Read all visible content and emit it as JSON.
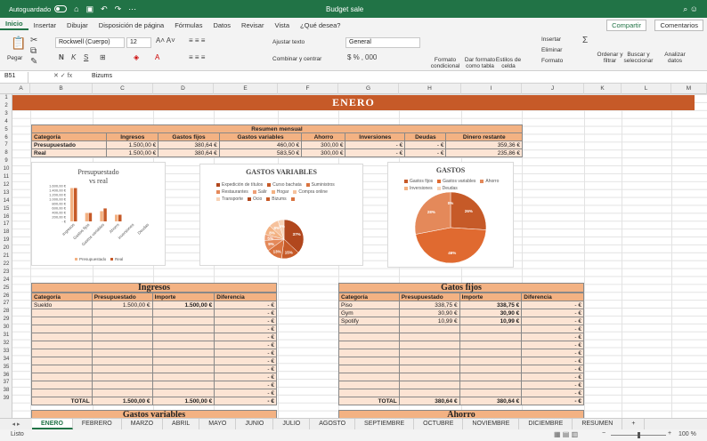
{
  "titlebar": {
    "autosave": "Autoguardado",
    "doc_title": "Budget sale"
  },
  "ribbon_tabs": [
    "Inicio",
    "Insertar",
    "Dibujar",
    "Disposición de página",
    "Fórmulas",
    "Datos",
    "Revisar",
    "Vista",
    "¿Qué desea?"
  ],
  "share": "Compartir",
  "comments": "Comentarios",
  "ribbon": {
    "paste": "Pegar",
    "font_name": "Rockwell (Cuerpo)",
    "font_size": "12",
    "wrap": "Ajustar texto",
    "merge": "Combinar y centrar",
    "number_format": "General",
    "cond_format": "Formato condicional",
    "table_format": "Dar formato como tabla",
    "cell_styles": "Estilos de celda",
    "insert": "Insertar",
    "delete": "Eliminar",
    "format": "Formato",
    "sort": "Ordenar y filtrar",
    "find": "Buscar y seleccionar",
    "analyze": "Analizar datos"
  },
  "formula_bar": {
    "cell": "B51",
    "value": "Bizums"
  },
  "columns": [
    "A",
    "B",
    "C",
    "D",
    "E",
    "F",
    "G",
    "H",
    "I",
    "J",
    "K",
    "L",
    "M"
  ],
  "rows": [
    "1",
    "2",
    "3",
    "4",
    "5",
    "6",
    "7",
    "8",
    "9",
    "10",
    "11",
    "12",
    "13",
    "14",
    "15",
    "16",
    "17",
    "18",
    "19",
    "20",
    "21",
    "22",
    "23",
    "24",
    "25",
    "26",
    "27",
    "28",
    "29",
    "30",
    "31",
    "32",
    "33",
    "34",
    "35",
    "36",
    "37",
    "38",
    "39"
  ],
  "banner": "ENERO",
  "summary": {
    "title": "Resumen mensual",
    "headers": [
      "Categoría",
      "Ingresos",
      "Gastos fijos",
      "Gastos variables",
      "Ahorro",
      "Inversiones",
      "Deudas",
      "Dinero restante"
    ],
    "rows": [
      [
        "Presupuestado",
        "1.500,00 €",
        "380,64 €",
        "460,00 €",
        "300,00 €",
        "-  €",
        "-  €",
        "359,36 €"
      ],
      [
        "Real",
        "1.500,00 €",
        "380,64 €",
        "583,50 €",
        "300,00 €",
        "-  €",
        "-  €",
        "235,86 €"
      ]
    ]
  },
  "chart1": {
    "title_line1": "Presupuestado",
    "title_line2": "vs real",
    "ticks": [
      "1.600,00 €",
      "1.400,00 €",
      "1.200,00 €",
      "1.000,00 €",
      "800,00 €",
      "600,00 €",
      "400,00 €",
      "200,00 €",
      "- €"
    ]
  },
  "chart2": {
    "title": "GASTOS VARIABLES"
  },
  "chart3": {
    "title": "GASTOS"
  },
  "chart_data": [
    {
      "type": "bar",
      "categories": [
        "Ingresos",
        "Gastos fijos",
        "Gastos variables",
        "Ahorro",
        "Inversiones",
        "Deudas"
      ],
      "series": [
        {
          "name": "Presupuestado",
          "values": [
            1500,
            380.64,
            460,
            300,
            0,
            0
          ]
        },
        {
          "name": "Real",
          "values": [
            1500,
            380.64,
            583.5,
            300,
            0,
            0
          ]
        }
      ],
      "ylim": [
        0,
        1600
      ]
    },
    {
      "type": "pie",
      "legend": [
        "Expedición de títulos",
        "Curso bachata",
        "Suministros",
        "Restaurantes",
        "Salir",
        "Hogar",
        "Compra online",
        "Transporte",
        "Ocio",
        "Bizums",
        ""
      ],
      "labels": [
        "37%",
        "15%",
        "13%",
        "9%",
        "5%",
        "8%",
        "8%",
        "5%"
      ],
      "values": [
        37,
        15,
        13,
        9,
        5,
        8,
        8,
        5
      ]
    },
    {
      "type": "pie",
      "legend": [
        "Gastos fijos",
        "Gastos variables",
        "Ahorro",
        "Inversiones",
        "Deudas"
      ],
      "labels": [
        "26%",
        "46%",
        "28%",
        "0%"
      ],
      "values": [
        26,
        46,
        28,
        0
      ]
    }
  ],
  "ingresos": {
    "title": "Ingresos",
    "headers": [
      "Categoría",
      "Presupuestado",
      "Importe",
      "Diferencia"
    ],
    "rows": [
      [
        "Sueldo",
        "1.500,00 €",
        "1.500,00 €",
        "-  €"
      ]
    ],
    "empty_diff": "-  €",
    "total": [
      "TOTAL",
      "1.500,00 €",
      "1.500,00 €",
      "-  €"
    ]
  },
  "gastos_fijos": {
    "title": "Gatos fijos",
    "headers": [
      "Categoría",
      "Presupuestado",
      "Importe",
      "Diferencia"
    ],
    "rows": [
      [
        "Piso",
        "338,75 €",
        "338,75 €",
        "-  €"
      ],
      [
        "Gym",
        "30,90 €",
        "30,90 €",
        "-  €"
      ],
      [
        "Spotify",
        "10,99 €",
        "10,99 €",
        "-  €"
      ]
    ],
    "empty_diff": "-  €",
    "total": [
      "TOTAL",
      "380,64 €",
      "380,64 €",
      "-  €"
    ]
  },
  "bottom_titles": {
    "left": "Gastos variables",
    "right": "Ahorro"
  },
  "sheet_tabs": [
    "ENERO",
    "FEBRERO",
    "MARZO",
    "ABRIL",
    "MAYO",
    "JUNIO",
    "JULIO",
    "AGOSTO",
    "SEPTIEMBRE",
    "OCTUBRE",
    "NOVIEMBRE",
    "DICIEMBRE",
    "RESUMEN"
  ],
  "status": {
    "left": "Listo",
    "zoom": "100 %"
  },
  "colors": {
    "accent": "#217346",
    "banner": "#c65a28",
    "header": "#f3b283",
    "peach": "#fce4d4"
  }
}
